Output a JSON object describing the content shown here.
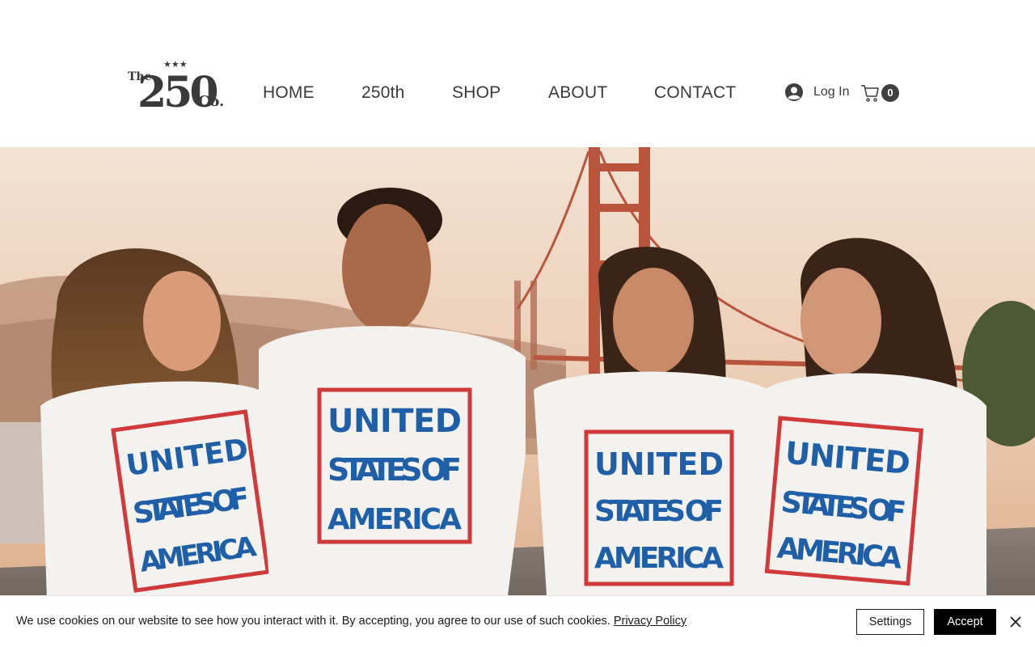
{
  "brand": {
    "logo_name": "The 250 Co.",
    "logo_parts": {
      "prefix": "The",
      "number": "250",
      "suffix": "Co.",
      "stars": "★★★"
    }
  },
  "nav": {
    "items": [
      {
        "label": "HOME"
      },
      {
        "label": "250th"
      },
      {
        "label": "SHOP"
      },
      {
        "label": "ABOUT"
      },
      {
        "label": "CONTACT"
      }
    ]
  },
  "account": {
    "login_label": "Log In",
    "icon": "user-avatar-icon"
  },
  "cart": {
    "count": "0",
    "icon": "shopping-cart-icon"
  },
  "hero": {
    "shirt_text": [
      "UNITED",
      "STATES OF",
      "AMERICA"
    ],
    "colors": {
      "sky": "#e9cdb8",
      "shirt_blue": "#1f5fa8",
      "shirt_red": "#d03a3a",
      "bridge": "#b8553c"
    }
  },
  "cookie_banner": {
    "message": "We use cookies on our website to see how you interact with it. By accepting, you agree to our use of such cookies.",
    "privacy_link": "Privacy Policy",
    "settings_label": "Settings",
    "accept_label": "Accept",
    "close_icon": "close-icon"
  }
}
